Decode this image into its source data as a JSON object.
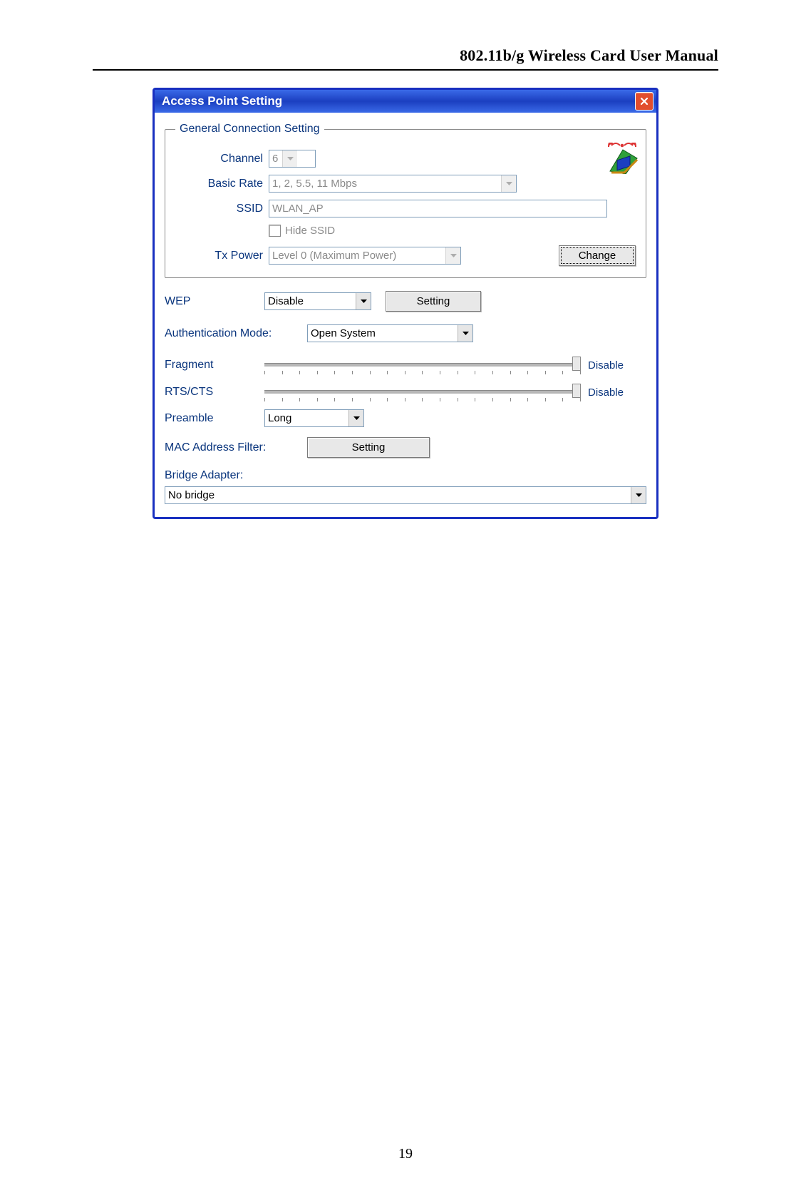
{
  "page": {
    "header": "802.11b/g Wireless Card User Manual",
    "number": "19"
  },
  "dialog": {
    "title": "Access Point Setting",
    "general": {
      "legend": "General Connection Setting",
      "channel_label": "Channel",
      "channel_value": "6",
      "basic_rate_label": "Basic Rate",
      "basic_rate_value": "1, 2, 5.5, 11 Mbps",
      "ssid_label": "SSID",
      "ssid_value": "WLAN_AP",
      "hide_ssid_label": "Hide SSID",
      "tx_power_label": "Tx Power",
      "tx_power_value": "Level 0 (Maximum Power)",
      "change_button": "Change"
    },
    "wep": {
      "label": "WEP",
      "value": "Disable",
      "setting_button": "Setting"
    },
    "auth": {
      "label": "Authentication Mode:",
      "value": "Open System"
    },
    "fragment": {
      "label": "Fragment",
      "value": "Disable"
    },
    "rtscts": {
      "label": "RTS/CTS",
      "value": "Disable"
    },
    "preamble": {
      "label": "Preamble",
      "value": "Long"
    },
    "mac_filter": {
      "label": "MAC Address Filter:",
      "setting_button": "Setting"
    },
    "bridge": {
      "label": "Bridge Adapter:",
      "value": "No bridge"
    }
  }
}
